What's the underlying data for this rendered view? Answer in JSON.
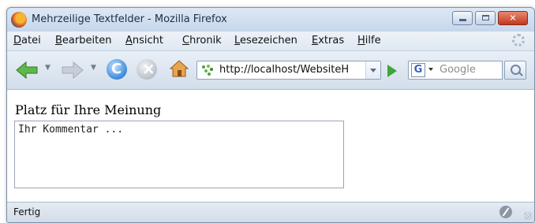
{
  "window": {
    "title": "Mehrzeilige Textfelder - Mozilla Firefox",
    "controls": {
      "minimize": "minimize-icon",
      "maximize": "maximize-icon",
      "close": "close-icon"
    }
  },
  "menu": {
    "items": [
      {
        "label": "Datei"
      },
      {
        "label": "Bearbeiten"
      },
      {
        "label": "Ansicht"
      },
      {
        "label": "Chronik"
      },
      {
        "label": "Lesezeichen"
      },
      {
        "label": "Extras"
      },
      {
        "label": "Hilfe"
      }
    ]
  },
  "toolbar": {
    "url": "http://localhost/WebsiteH",
    "search_engine_icon": "G",
    "search_placeholder": "Google",
    "icons": [
      "back-icon",
      "forward-icon",
      "reload-icon",
      "stop-icon",
      "home-icon",
      "go-icon",
      "search-icon"
    ]
  },
  "content": {
    "label": "Platz für Ihre Meinung",
    "textarea_value": "Ihr Kommentar ..."
  },
  "status": {
    "text": "Fertig"
  }
}
